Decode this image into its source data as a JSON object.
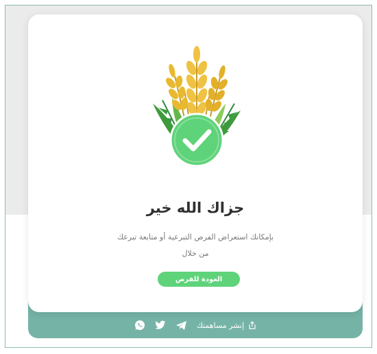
{
  "success": {
    "title": "جزاك الله خير",
    "description_line1": "بإمكانك استعراض الفرص التبرعية أو متابعة تبرعك",
    "description_line2": "من خلال",
    "back_button_label": "العودة للفرص"
  },
  "share": {
    "label": "إنشر مساهمتك",
    "icons": [
      "share-icon",
      "telegram-icon",
      "twitter-icon",
      "whatsapp-icon"
    ]
  },
  "colors": {
    "accent_green": "#5fd37a",
    "teal_bar": "#75b3a6",
    "check_circle": "#5fd37a"
  }
}
